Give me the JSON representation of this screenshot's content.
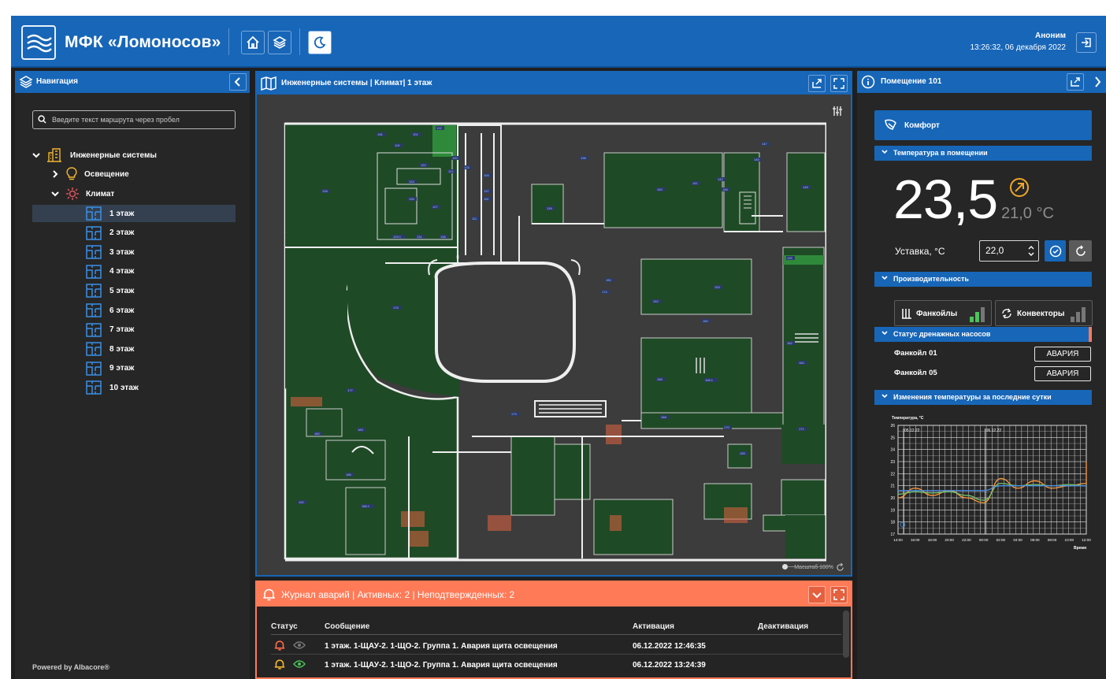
{
  "header": {
    "title": "МФК «Ломоносов»",
    "user": "Аноним",
    "datetime": "13:26:32, 06 декабря 2022"
  },
  "nav": {
    "title": "Навигация",
    "search_placeholder": "Введите текст маршрута через пробел",
    "root": "Инженерные системы",
    "lighting": "Освещение",
    "climate": "Климат",
    "floors": [
      "1 этаж",
      "2 этаж",
      "3 этаж",
      "4 этаж",
      "5 этаж",
      "6 этаж",
      "7 этаж",
      "8 этаж",
      "9 этаж",
      "10 этаж"
    ],
    "powered": "Powered by Albacore®"
  },
  "map": {
    "title": "Инженерные системы | Климат| 1 этаж",
    "scale": "Масштаб 100%",
    "rooms": [
      "118",
      "119",
      "101",
      "102",
      "103",
      "104",
      "110",
      "111",
      "120",
      "121",
      "122",
      "124",
      "126",
      "127",
      "128",
      "129.1",
      "131",
      "136",
      "137",
      "138",
      "139",
      "140",
      "141",
      "142",
      "145",
      "146",
      "147",
      "148",
      "150",
      "152",
      "153",
      "155",
      "160",
      "162",
      "164",
      "165",
      "166.1",
      "168",
      "170",
      "171",
      "173",
      "174",
      "176",
      "177",
      "180",
      "183",
      "186",
      "186.1",
      "192",
      "195"
    ]
  },
  "room": {
    "title": "Помещение 101",
    "mode": "Комфорт",
    "temp_section": "Температура в помещении",
    "temp": "23,5",
    "temp_alt": "21,0 °C",
    "setpoint_label": "Уставка, °C",
    "setpoint_value": "22,0",
    "perf_section": "Производительность",
    "fancoils": "Фанкойлы",
    "convectors": "Конвекторы",
    "drain_section": "Статус дренажных насосов",
    "drain_rows": [
      {
        "name": "Фанкойл 01",
        "status": "АВАРИЯ"
      },
      {
        "name": "Фанкойл 05",
        "status": "АВАРИЯ"
      }
    ],
    "chart_section": "Изменения температуры за последние сутки",
    "accent": "#1766b8",
    "alarm_color": "#ff7a57"
  },
  "chart_data": {
    "type": "line",
    "title": "",
    "ylabel": "Температура, °C",
    "xlabel": "Время",
    "ylim": [
      17,
      26
    ],
    "yticks": [
      17,
      18,
      19,
      20,
      21,
      22,
      23,
      24,
      25,
      26
    ],
    "date_labels": [
      "05.12.22",
      "06.12.22"
    ],
    "x": [
      "14:00",
      "16:00",
      "18:00",
      "20:00",
      "22:00",
      "00:00",
      "02:00",
      "04:00",
      "06:00",
      "08:00",
      "10:00",
      "12:00"
    ],
    "series": [
      {
        "values": [
          20.0,
          20.8,
          20.2,
          20.6,
          20.0,
          19.6,
          21.6,
          20.8,
          21.4,
          20.8,
          21.0,
          21.2
        ],
        "color": "#ff9a3c"
      },
      {
        "values": [
          20.3,
          20.5,
          20.4,
          20.5,
          20.2,
          19.8,
          21.2,
          21.0,
          21.1,
          21.0,
          21.1,
          21.0
        ],
        "color": "#74c06a"
      },
      {
        "values": [
          20.6,
          20.6,
          20.6,
          20.6,
          20.6,
          20.6,
          21.0,
          21.0,
          21.0,
          21.0,
          21.0,
          21.0
        ],
        "color": "#4c8fe6"
      }
    ],
    "end_value": 23
  },
  "alarms": {
    "title": "Журнал аварий | Активных: 2 | Неподтвержденных: 2",
    "columns": {
      "status": "Статус",
      "message": "Сообщение",
      "activation": "Активация",
      "deactivation": "Деактивация"
    },
    "rows": [
      {
        "message": "1 этаж. 1-ЩАУ-2. 1-ЩО-2. Группа 1. Авария щита освещения",
        "activation": "06.12.2022 12:46:35",
        "deactivation": ""
      },
      {
        "message": "1 этаж. 1-ЩАУ-2. 1-ЩО-2. Группа 1. Авария щита освещения",
        "activation": "06.12.2022 13:24:39",
        "deactivation": ""
      }
    ]
  }
}
